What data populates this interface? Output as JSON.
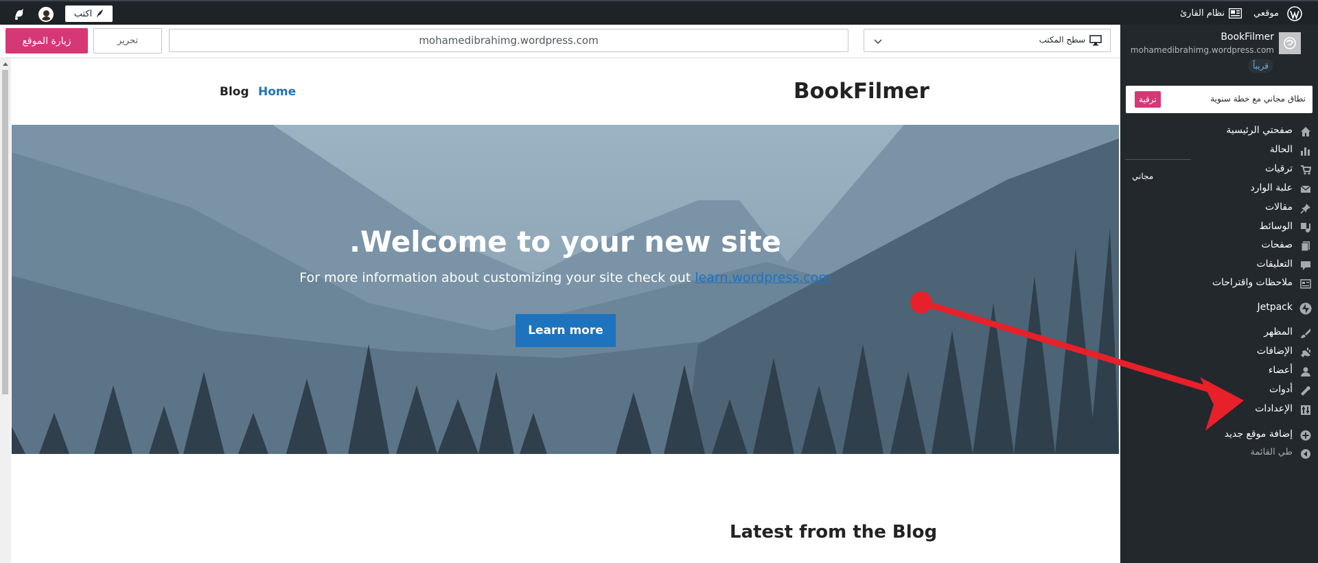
{
  "adminbar": {
    "write_label": "اكتب",
    "my_site": "موقعي",
    "reader": "نظام القارئ"
  },
  "sidebar": {
    "site_name": "BookFilmer",
    "site_url": "mohamedibrahimg.wordpress.com",
    "coming_badge": "قريباً",
    "upgrade_text": "نطاق مجاني مع خطة سنوية",
    "upgrade_button": "ترقية",
    "free_label": "مجاني",
    "items": [
      {
        "label": "صفحتي الرئيسية",
        "icon": "home-icon"
      },
      {
        "label": "الحالة",
        "icon": "stats-icon"
      },
      {
        "label": "ترقيات",
        "icon": "cart-icon"
      },
      {
        "label": "علبة الوارد",
        "icon": "mail-icon"
      },
      {
        "label": "مقالات",
        "icon": "pin-icon"
      },
      {
        "label": "الوسائط",
        "icon": "media-icon"
      },
      {
        "label": "صفحات",
        "icon": "pages-icon"
      },
      {
        "label": "التعليقات",
        "icon": "comments-icon"
      },
      {
        "label": "ملاحظات واقتراحات",
        "icon": "feedback-icon"
      },
      {
        "label": "Jetpack",
        "icon": "jetpack-icon"
      },
      {
        "label": "المظهر",
        "icon": "appearance-icon"
      },
      {
        "label": "الإضافات",
        "icon": "plugins-icon"
      },
      {
        "label": "أعضاء",
        "icon": "users-icon"
      },
      {
        "label": "أدوات",
        "icon": "tools-icon"
      },
      {
        "label": "الإعدادات",
        "icon": "settings-icon"
      },
      {
        "label": "إضافة موقع جديد",
        "icon": "add-site-icon"
      },
      {
        "label": "طي القائمة",
        "icon": "collapse-icon"
      }
    ]
  },
  "toolbar": {
    "visit_label": "زيارة الموقع",
    "edit_label": "تحرير",
    "url": "mohamedibrahimg.wordpress.com",
    "device_label": "سطح المكتب"
  },
  "preview": {
    "site_title": "BookFilmer",
    "nav_home": "Home",
    "nav_blog": "Blog",
    "hero_title": ".Welcome to your new site",
    "hero_sub_prefix": "For more information about customizing your site check out ",
    "hero_sub_link": "learn.wordpress.com",
    "learn_more": "Learn more",
    "latest_heading": "Latest from the Blog"
  },
  "colors": {
    "admin_bg": "#1d2327",
    "sidebar_bg": "#23282d",
    "accent_pink": "#d63775",
    "link_blue": "#1e73be",
    "annotation_red": "#e8202a"
  }
}
